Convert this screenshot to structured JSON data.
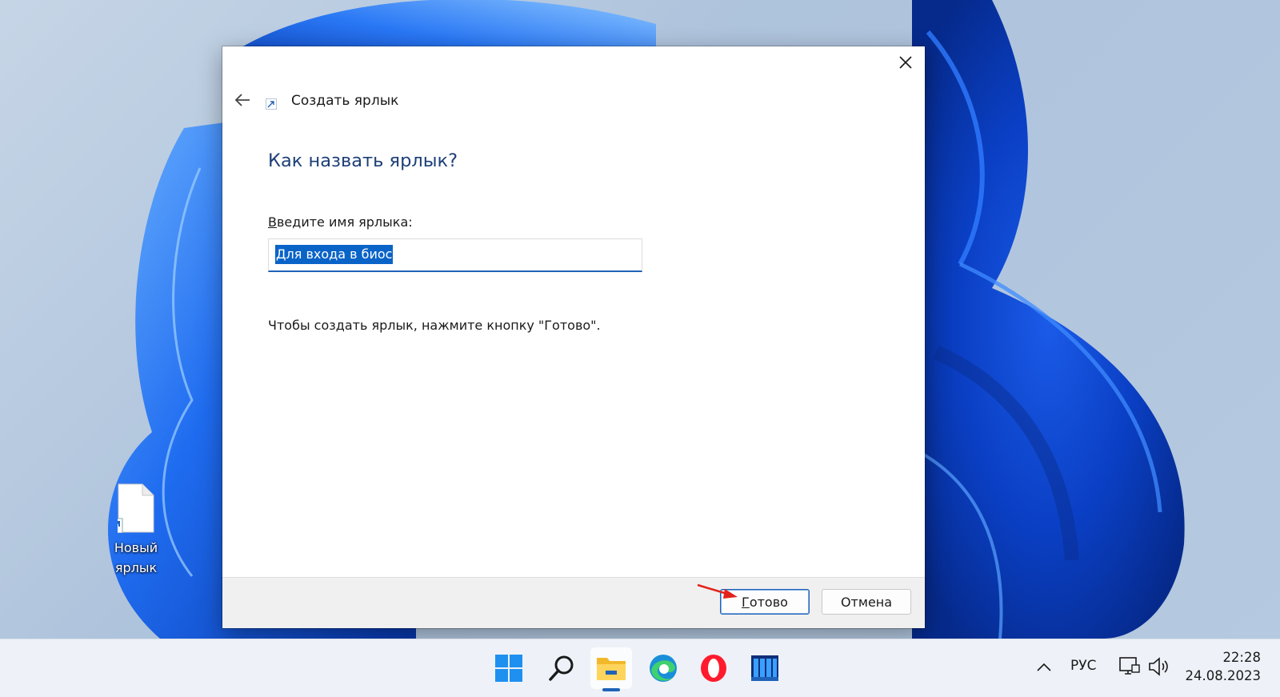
{
  "desktop": {
    "shortcut_icon": {
      "label": "Новый ярлык",
      "icon": "shortcut-file-icon"
    }
  },
  "dialog": {
    "wizard_title": "Создать ярлык",
    "heading": "Как назвать ярлык?",
    "name_label_accel": "В",
    "name_label_rest": "ведите имя ярлыка:",
    "name_input_value": "Для входа в биос",
    "hint": "Чтобы создать ярлык, нажмите кнопку \"Готово\".",
    "finish_accel": "Г",
    "finish_rest": "отово",
    "cancel_label": "Отмена",
    "icons": [
      "back-arrow-icon",
      "shortcut-arrow-icon",
      "close-icon"
    ]
  },
  "taskbar": {
    "apps": [
      "start-icon",
      "search-icon",
      "file-explorer-icon",
      "edge-icon",
      "opera-icon",
      "app-icon"
    ],
    "lang": "РУС",
    "time": "22:28",
    "date": "24.08.2023"
  },
  "colors": {
    "accent": "#1f63b8",
    "heading": "#1d3f78",
    "selection": "#0a64c8"
  }
}
